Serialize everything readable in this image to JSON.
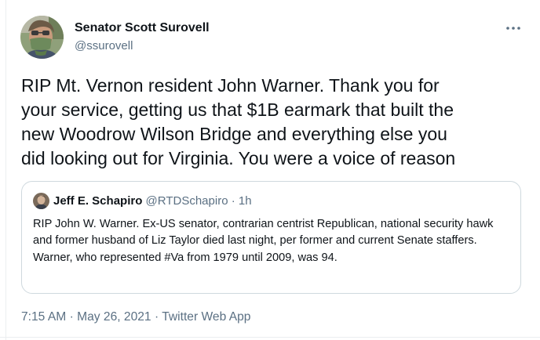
{
  "author": {
    "display_name": "Senator Scott Surovell",
    "handle": "@ssurovell",
    "avatar": "profile-photo"
  },
  "more_icon": "more-horizontal-icon",
  "tweet": {
    "text": "RIP Mt. Vernon resident John Warner.  Thank you for\nyour service, getting us that $1B earmark that built the\nnew Woodrow Wilson Bridge and everything else you\ndid looking out for Virginia.  You were a voice of reason"
  },
  "quoted_tweet": {
    "display_name": "Jeff E. Schapiro",
    "handle": "@RTDSchapiro",
    "separator": "·",
    "time": "1h",
    "text": "RIP John W. Warner. Ex-US senator, contrarian centrist Republican, national security hawk and former husband of Liz Taylor died last night, per former and current Senate staffers. Warner, who represented #Va from 1979 until 2009, was 94."
  },
  "meta": {
    "time": "7:15 AM",
    "sep1": "·",
    "date": "May 26, 2021",
    "sep2": "·",
    "source": "Twitter Web App"
  },
  "colors": {
    "text": "#0f1419",
    "secondary": "#5b7083",
    "border": "#cfd9de"
  }
}
